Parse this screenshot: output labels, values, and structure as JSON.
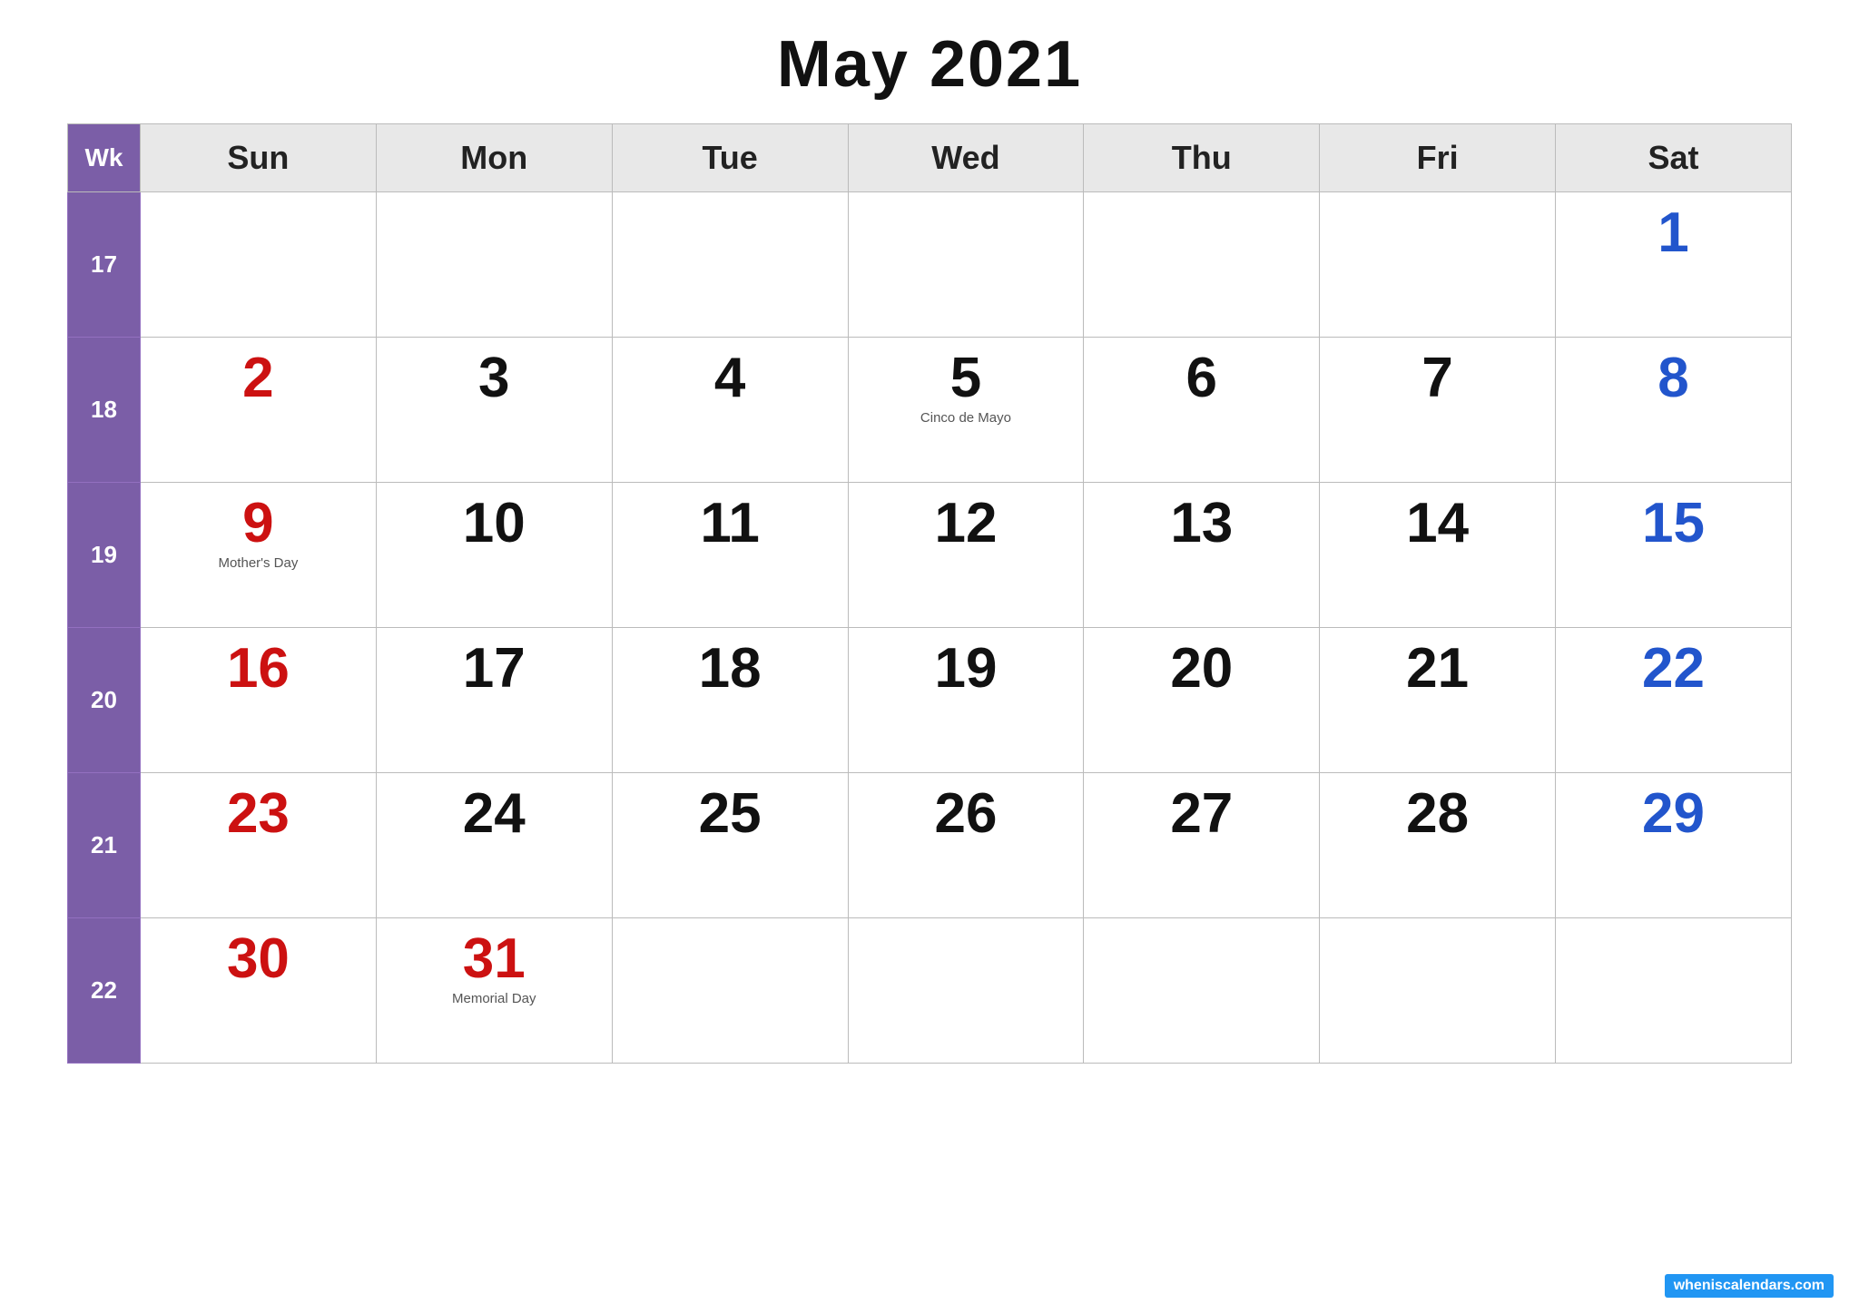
{
  "title": "May 2021",
  "header": {
    "wk": "Wk",
    "days": [
      "Sun",
      "Mon",
      "Tue",
      "Wed",
      "Thu",
      "Fri",
      "Sat"
    ]
  },
  "weeks": [
    {
      "wk": "17",
      "days": [
        {
          "num": "",
          "color": "black",
          "holiday": ""
        },
        {
          "num": "",
          "color": "black",
          "holiday": ""
        },
        {
          "num": "",
          "color": "black",
          "holiday": ""
        },
        {
          "num": "",
          "color": "black",
          "holiday": ""
        },
        {
          "num": "",
          "color": "black",
          "holiday": ""
        },
        {
          "num": "",
          "color": "black",
          "holiday": ""
        },
        {
          "num": "1",
          "color": "blue",
          "holiday": ""
        }
      ]
    },
    {
      "wk": "18",
      "days": [
        {
          "num": "2",
          "color": "red",
          "holiday": ""
        },
        {
          "num": "3",
          "color": "black",
          "holiday": ""
        },
        {
          "num": "4",
          "color": "black",
          "holiday": ""
        },
        {
          "num": "5",
          "color": "black",
          "holiday": "Cinco de Mayo"
        },
        {
          "num": "6",
          "color": "black",
          "holiday": ""
        },
        {
          "num": "7",
          "color": "black",
          "holiday": ""
        },
        {
          "num": "8",
          "color": "blue",
          "holiday": ""
        }
      ]
    },
    {
      "wk": "19",
      "days": [
        {
          "num": "9",
          "color": "red",
          "holiday": "Mother's Day"
        },
        {
          "num": "10",
          "color": "black",
          "holiday": ""
        },
        {
          "num": "11",
          "color": "black",
          "holiday": ""
        },
        {
          "num": "12",
          "color": "black",
          "holiday": ""
        },
        {
          "num": "13",
          "color": "black",
          "holiday": ""
        },
        {
          "num": "14",
          "color": "black",
          "holiday": ""
        },
        {
          "num": "15",
          "color": "blue",
          "holiday": ""
        }
      ]
    },
    {
      "wk": "20",
      "days": [
        {
          "num": "16",
          "color": "red",
          "holiday": ""
        },
        {
          "num": "17",
          "color": "black",
          "holiday": ""
        },
        {
          "num": "18",
          "color": "black",
          "holiday": ""
        },
        {
          "num": "19",
          "color": "black",
          "holiday": ""
        },
        {
          "num": "20",
          "color": "black",
          "holiday": ""
        },
        {
          "num": "21",
          "color": "black",
          "holiday": ""
        },
        {
          "num": "22",
          "color": "blue",
          "holiday": ""
        }
      ]
    },
    {
      "wk": "21",
      "days": [
        {
          "num": "23",
          "color": "red",
          "holiday": ""
        },
        {
          "num": "24",
          "color": "black",
          "holiday": ""
        },
        {
          "num": "25",
          "color": "black",
          "holiday": ""
        },
        {
          "num": "26",
          "color": "black",
          "holiday": ""
        },
        {
          "num": "27",
          "color": "black",
          "holiday": ""
        },
        {
          "num": "28",
          "color": "black",
          "holiday": ""
        },
        {
          "num": "29",
          "color": "blue",
          "holiday": ""
        }
      ]
    },
    {
      "wk": "22",
      "days": [
        {
          "num": "30",
          "color": "red",
          "holiday": ""
        },
        {
          "num": "31",
          "color": "red",
          "holiday": "Memorial Day"
        },
        {
          "num": "",
          "color": "black",
          "holiday": ""
        },
        {
          "num": "",
          "color": "black",
          "holiday": ""
        },
        {
          "num": "",
          "color": "black",
          "holiday": ""
        },
        {
          "num": "",
          "color": "black",
          "holiday": ""
        },
        {
          "num": "",
          "color": "black",
          "holiday": ""
        }
      ]
    }
  ],
  "watermark": "wheniscalendars.com"
}
